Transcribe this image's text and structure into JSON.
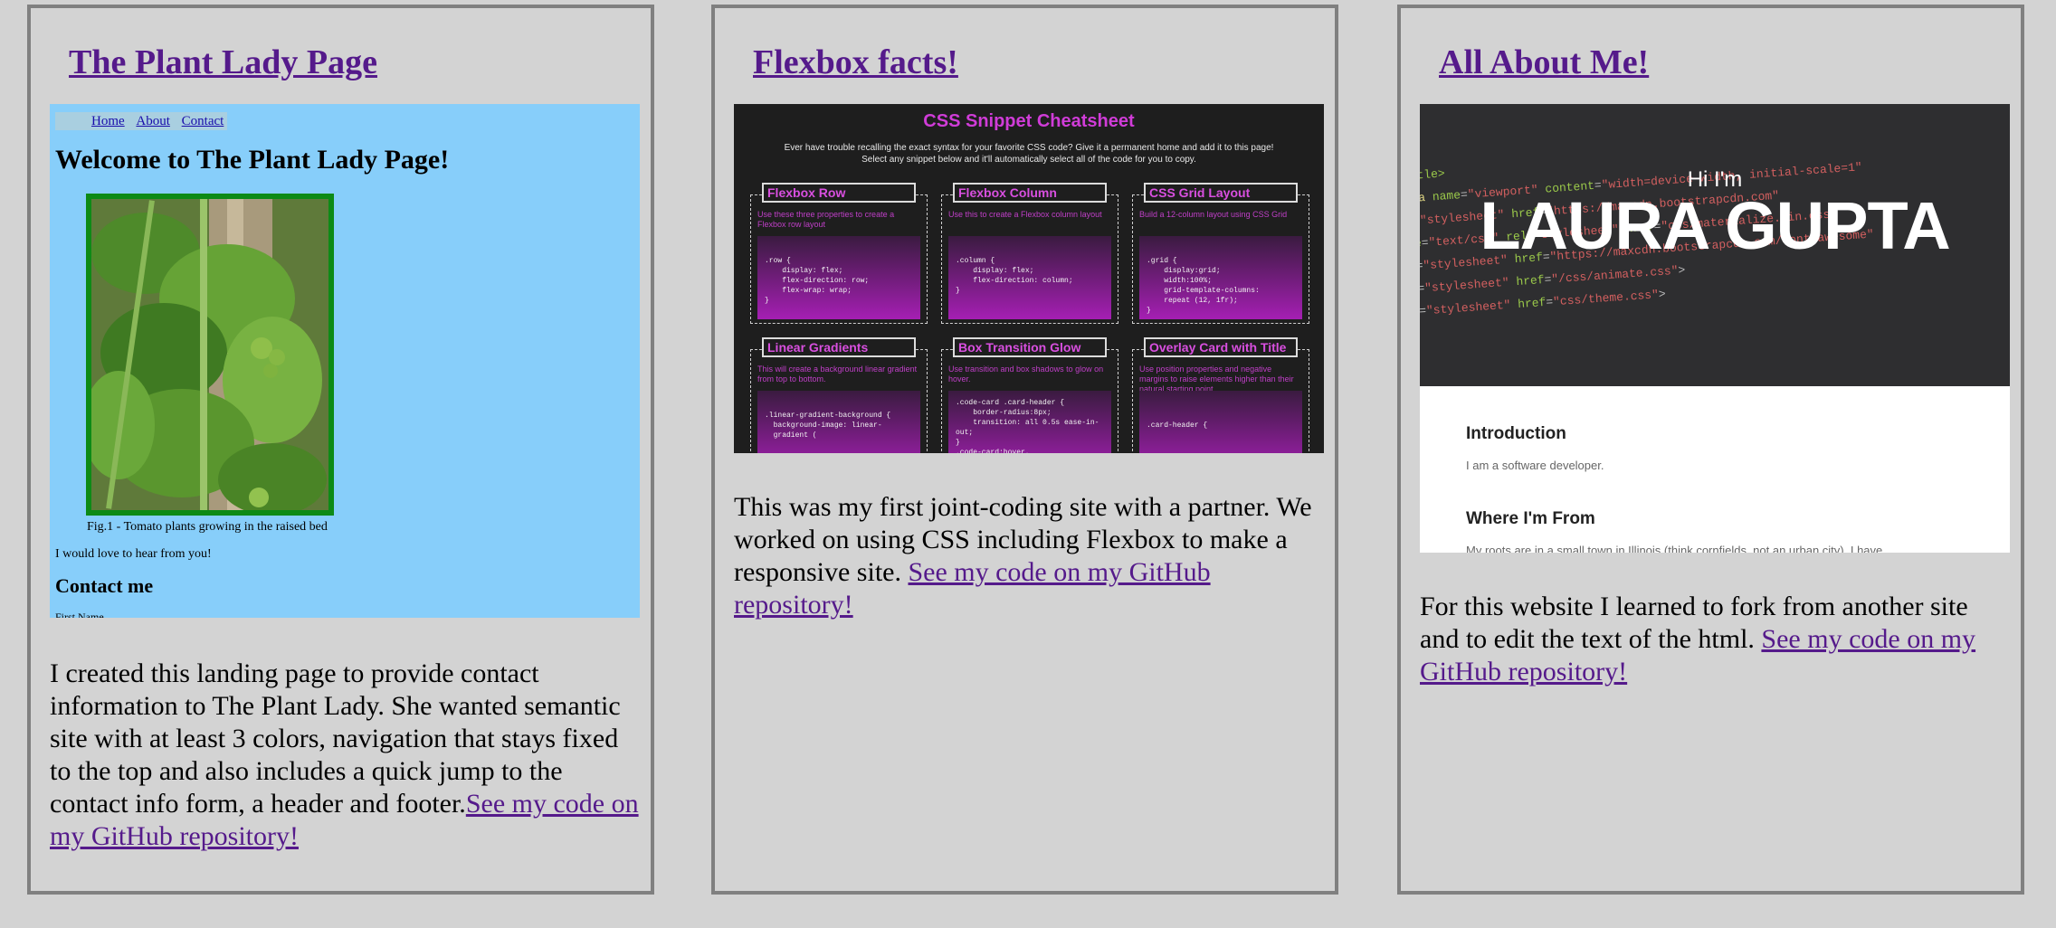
{
  "cards": [
    {
      "title": "The Plant Lady Page",
      "description": "I created this landing page to provide contact information to The Plant Lady. She wanted semantic site with at least 3 colors, navigation that stays fixed to the top and also includes a quick jump to the contact info form, a header and footer.",
      "link": "See my code on my GitHub repository!",
      "screenshot": {
        "nav": [
          "Home",
          "About",
          "Contact"
        ],
        "heading": "Welcome to The Plant Lady Page!",
        "caption": "Fig.1 - Tomato plants growing in the raised bed",
        "text": "I would love to hear from you!",
        "contact_heading": "Contact me",
        "first_field": "First Name"
      }
    },
    {
      "title": "Flexbox facts!",
      "description": "This was my first joint-coding site with a partner. We worked on using CSS including Flexbox to make a responsive site.",
      "link": "See my code on my GitHub repository!",
      "screenshot": {
        "title": "CSS Snippet Cheatsheet",
        "intro_1": "Ever have trouble recalling the exact syntax for your favorite CSS code? Give it a permanent home and add it to this page!",
        "intro_2": "Select any snippet below and it'll automatically select all of the code for you to copy.",
        "snippets": [
          {
            "label": "Flexbox Row",
            "desc": "Use these three properties to create a Flexbox row layout",
            "code": ".row {\n    display: flex;\n    flex-direction: row;\n    flex-wrap: wrap;\n}"
          },
          {
            "label": "Flexbox Column",
            "desc": "Use this to create a Flexbox column layout",
            "code": ".column {\n    display: flex;\n    flex-direction: column;\n}"
          },
          {
            "label": "CSS Grid Layout",
            "desc": "Build a 12-column layout using CSS Grid",
            "code": ".grid {\n    display:grid;\n    width:100%;\n    grid-template-columns:\n    repeat (12, 1fr);\n}"
          },
          {
            "label": "Linear Gradients",
            "desc": "This will create a background linear gradient from top to bottom.",
            "code": ".linear-gradient-background {\n  background-image: linear-\n  gradient ("
          },
          {
            "label": "Box Transition Glow",
            "desc": "Use transition and box shadows to glow on hover.",
            "code": ".code-card .card-header {\n    border-radius:8px;\n    transition: all 0.5s ease-in-\nout;\n}\n.code-card:hover,"
          },
          {
            "label": "Overlay Card with Title",
            "desc": "Use position properties and negative margins to raise elements higher than their natural starting point.",
            "code": "\n\n\n.card-header {"
          }
        ]
      }
    },
    {
      "title": "All About Me!",
      "description": "For this website I learned to fork from another site and to edit the text of the html.",
      "link": "See my code on my GitHub repository!",
      "screenshot": {
        "greeting": "Hi I'm",
        "name": "LAURA GUPTA",
        "sections": [
          {
            "heading": "Introduction",
            "text": "I am a software developer."
          },
          {
            "heading": "Where I'm From",
            "text": "My roots are in a small town in Illinois (think cornfields, not an urban city). I have"
          }
        ]
      }
    }
  ],
  "colors": {
    "page_background": "#d3d3d3",
    "card_border": "#808080",
    "link": "#551a8b",
    "plant_background": "#87cefa",
    "cheatsheet_accent": "#d03cd8"
  }
}
